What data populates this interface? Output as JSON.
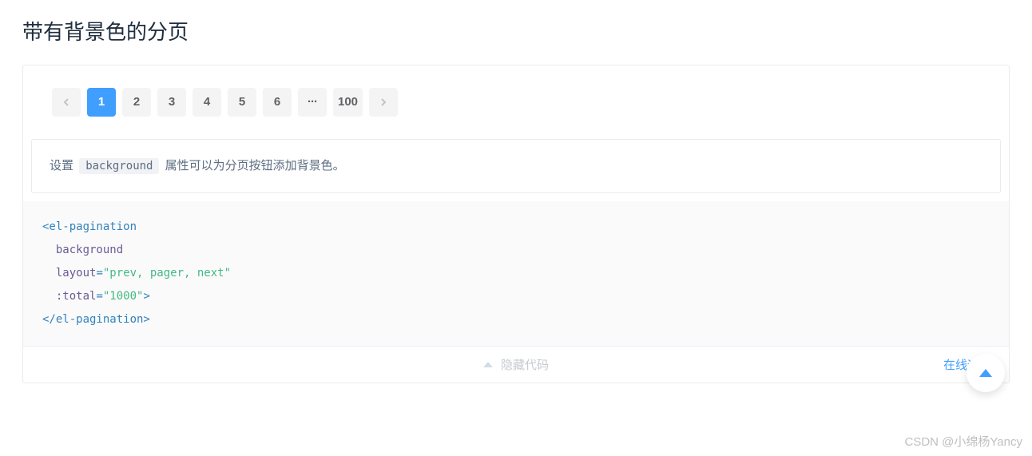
{
  "title": "带有背景色的分页",
  "pagination": {
    "pages": [
      "1",
      "2",
      "3",
      "4",
      "5",
      "6"
    ],
    "ellipsis": "···",
    "last": "100",
    "active_index": 0
  },
  "description": {
    "before": "设置",
    "code": "background",
    "after": "属性可以为分页按钮添加背景色。"
  },
  "code": {
    "line1": "<el-pagination",
    "line2_name": "background",
    "line3_name": "layout",
    "line3_val": "\"prev, pager, next\"",
    "line4_name": ":total",
    "line4_val": "\"1000\"",
    "line4_close": ">",
    "line5": "</el-pagination>"
  },
  "controls": {
    "hide": "隐藏代码",
    "run": "在线运行"
  },
  "watermark": "CSDN @小绵杨Yancy"
}
